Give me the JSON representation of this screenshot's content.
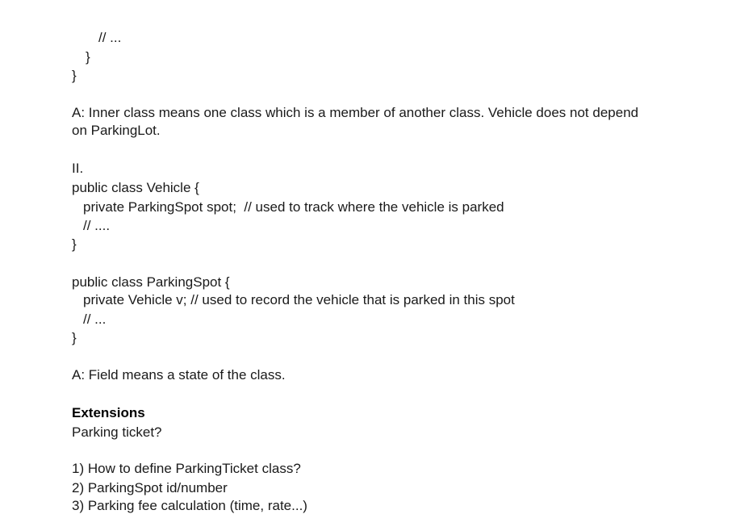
{
  "document": {
    "code_a": {
      "comment": "// ...",
      "inner_close": "}",
      "outer_close": "}"
    },
    "answer_1": {
      "line1": "A: Inner class means one class which is a member of another class. Vehicle does not depend",
      "line2": "on ParkingLot."
    },
    "section_2": {
      "heading": "II.",
      "vehicle_decl": "public class Vehicle {",
      "vehicle_field": "private ParkingSpot spot;  // used to track where the vehicle is parked",
      "vehicle_comment": "// ....",
      "vehicle_close": "}",
      "spot_decl": "public class ParkingSpot {",
      "spot_field": "private Vehicle v; // used to record the vehicle that is parked in this spot",
      "spot_comment": "// ...",
      "spot_close": "}"
    },
    "answer_2": "A: Field means a state of the class.",
    "extensions": {
      "heading": "Extensions",
      "question": "Parking ticket?",
      "items": [
        "1) How to define ParkingTicket class?",
        "2) ParkingSpot id/number",
        "3) Parking fee calculation (time, rate...)"
      ]
    }
  }
}
